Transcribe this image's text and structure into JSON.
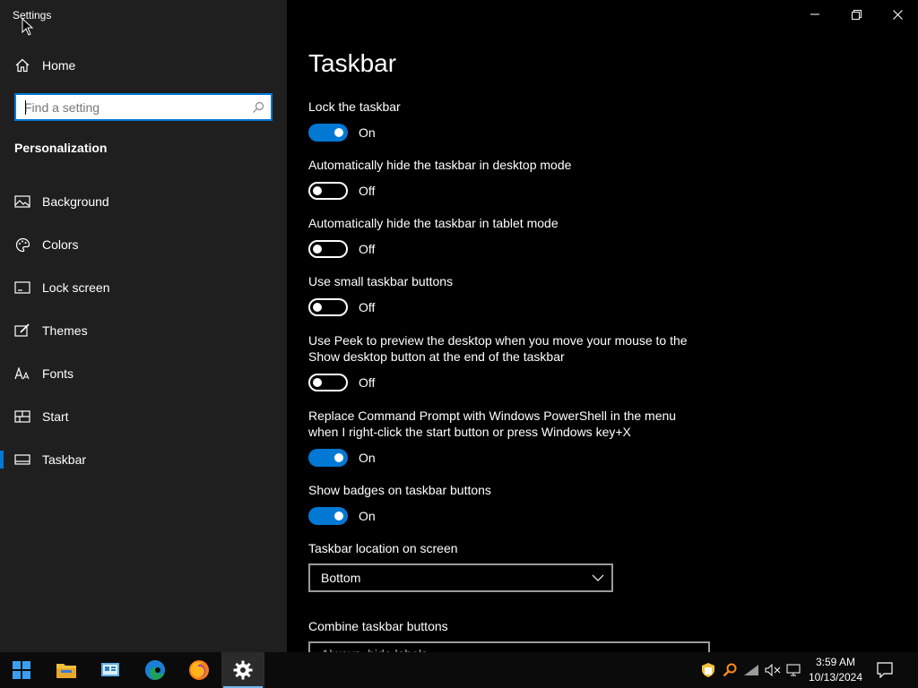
{
  "window": {
    "app_title": "Settings",
    "controls": {
      "minimize": "minimize-icon",
      "restore": "restore-icon",
      "close": "close-icon"
    }
  },
  "sidebar": {
    "home_label": "Home",
    "search_placeholder": "Find a setting",
    "section_title": "Personalization",
    "items": [
      {
        "label": "Background",
        "icon": "image-icon"
      },
      {
        "label": "Colors",
        "icon": "palette-icon"
      },
      {
        "label": "Lock screen",
        "icon": "lock-screen-icon"
      },
      {
        "label": "Themes",
        "icon": "themes-icon"
      },
      {
        "label": "Fonts",
        "icon": "font-icon"
      },
      {
        "label": "Start",
        "icon": "start-icon"
      },
      {
        "label": "Taskbar",
        "icon": "taskbar-icon",
        "active": true
      }
    ]
  },
  "main": {
    "title": "Taskbar",
    "settings": [
      {
        "label": "Lock the taskbar",
        "state": "On"
      },
      {
        "label": "Automatically hide the taskbar in desktop mode",
        "state": "Off"
      },
      {
        "label": "Automatically hide the taskbar in tablet mode",
        "state": "Off"
      },
      {
        "label": "Use small taskbar buttons",
        "state": "Off"
      },
      {
        "label_line1": "Use Peek to preview the desktop when you move your mouse to the",
        "label_line2": "Show desktop button at the end of the taskbar",
        "state": "Off"
      },
      {
        "label_line1": "Replace Command Prompt with Windows PowerShell in the menu",
        "label_line2": "when I right-click the start button or press Windows key+X",
        "state": "On"
      },
      {
        "label": "Show badges on taskbar buttons",
        "state": "On"
      }
    ],
    "location_label": "Taskbar location on screen",
    "location_value": "Bottom",
    "combine_label": "Combine taskbar buttons",
    "combine_value": "Always, hide labels"
  },
  "taskbar": {
    "apps": [
      "windows-start-icon",
      "file-explorer-icon",
      "control-panel-icon",
      "edge-icon",
      "firefox-icon",
      "settings-icon"
    ],
    "tray": [
      "security-shield-icon",
      "search-tray-icon",
      "network-icon",
      "volume-muted-icon",
      "display-icon"
    ],
    "time": "3:59 AM",
    "date": "10/13/2024"
  },
  "colors": {
    "accent": "#0078d4",
    "sidebar_bg": "#1f1f1f",
    "main_bg": "#000000"
  }
}
